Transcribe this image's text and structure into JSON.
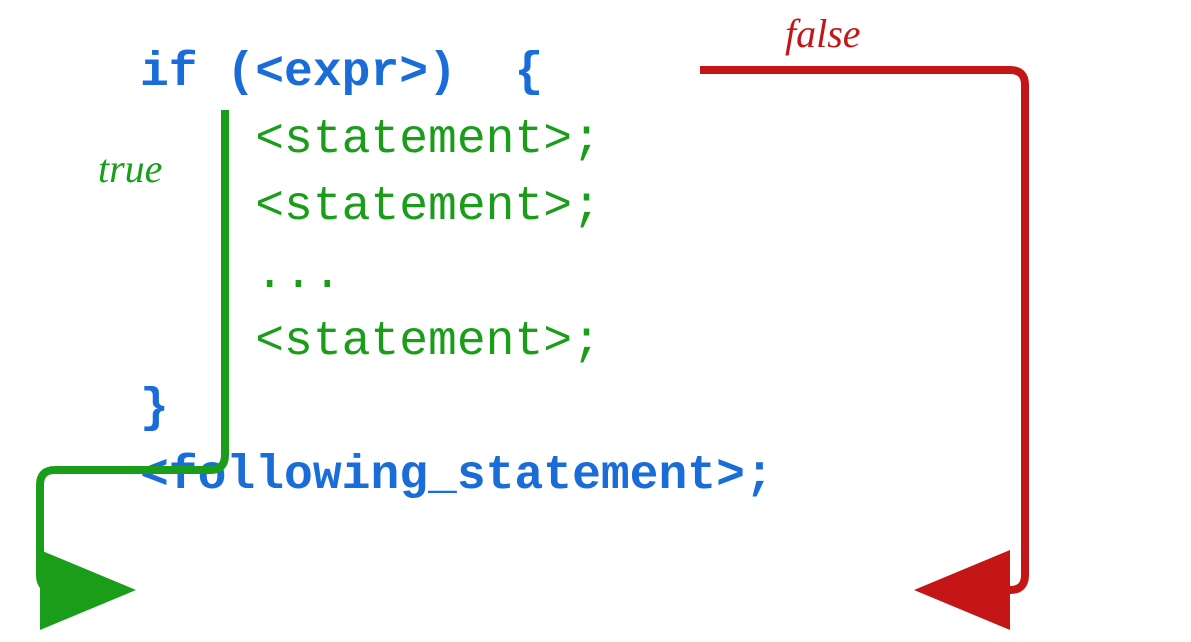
{
  "diagram": {
    "type": "control-flow",
    "construct": "if-block",
    "line1_keyword": "if",
    "line1_expr": "(<expr>)",
    "line1_brace": "{",
    "body_lines": [
      "<statement>;",
      "<statement>;",
      "...",
      "<statement>;"
    ],
    "close_brace": "}",
    "following": "<following_statement>;",
    "labels": {
      "true": "true",
      "false": "false"
    },
    "colors": {
      "keyword": "#1a6dd9",
      "statement": "#1a9e1a",
      "true_arrow": "#1a9e1a",
      "false_arrow": "#c41616"
    }
  }
}
